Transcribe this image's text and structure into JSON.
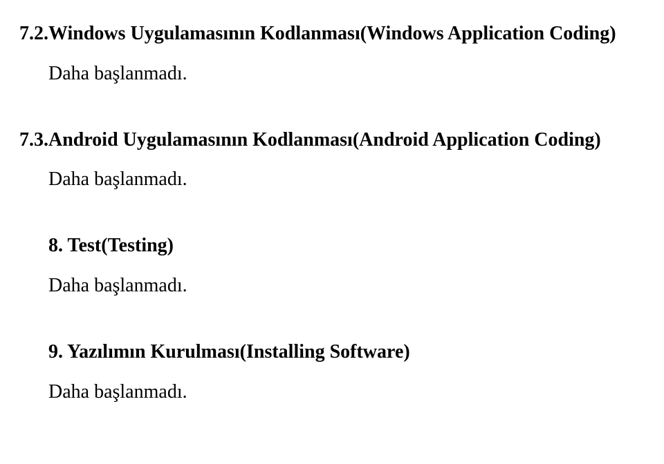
{
  "sections": [
    {
      "heading": "7.2.Windows Uygulamasının Kodlanması(Windows Application Coding)",
      "body": "Daha başlanmadı.",
      "heading_indented": false,
      "body_indented": true
    },
    {
      "heading": "7.3.Android Uygulamasının Kodlanması(Android Application Coding)",
      "body": "Daha başlanmadı.",
      "heading_indented": false,
      "body_indented": true
    },
    {
      "heading": "8. Test(Testing)",
      "body": "Daha başlanmadı.",
      "heading_indented": true,
      "body_indented": true
    },
    {
      "heading": "9. Yazılımın Kurulması(Installing Software)",
      "body": "Daha başlanmadı.",
      "heading_indented": true,
      "body_indented": true
    }
  ]
}
